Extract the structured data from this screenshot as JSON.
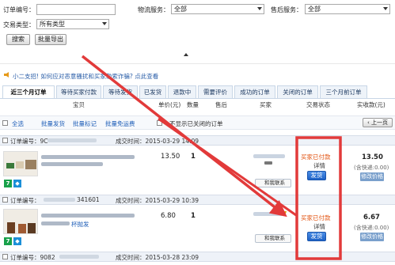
{
  "search": {
    "order_no_label": "订单编号：",
    "logistics_label": "物流服务：",
    "logistics_value": "全部",
    "aftersale_label": "售后服务：",
    "aftersale_value": "全部",
    "trade_type_label": "交易类型：",
    "trade_type_value": "所有类型",
    "search_button": "搜索",
    "export_button": "批量导出"
  },
  "notice": {
    "text": "小二支招! 如何应对恶意骚扰和买家勒索诈骗? 点此查看"
  },
  "tabs": [
    "近三个月订单",
    "等待买家付款",
    "等待发货",
    "已发货",
    "退款中",
    "需要评价",
    "成功的订单",
    "关闭的订单",
    "三个月前订单"
  ],
  "columns": {
    "item": "宝贝",
    "unit_price": "单价(元)",
    "quantity": "数量",
    "aftersale": "售后",
    "buyer": "买家",
    "trade_status": "交易状态",
    "paid": "实收款(元)"
  },
  "bulk": {
    "select_all": "全选",
    "batch_ship": "批量发货",
    "batch_mark": "批量标记",
    "batch_free_ship": "批量免运费",
    "hide_closed": "不显示已关闭的订单",
    "prev_page": "上一页"
  },
  "orders": [
    {
      "order_no": "订单编号：9C",
      "created": "成交时间：2015-03-29  14:09",
      "price": "13.50",
      "qty": "1",
      "status": "买家已付款",
      "detail": "详情",
      "ship": "发货",
      "total": "13.50",
      "shipping_note": "(含快递:0.00)",
      "modify_price": "修改价格",
      "msg": "和我联系"
    },
    {
      "order_no": "订单编号：",
      "order_no_tail": "341601",
      "created": "成交时间：2015-03-29  10:39",
      "price": "6.80",
      "qty": "1",
      "status": "买家已付款",
      "detail": "详情",
      "ship": "发货",
      "total": "6.67",
      "shipping_note": "(含快递:0.00)",
      "modify_price": "修改价格",
      "msg": "和我联系",
      "title_tail": "杯抛发"
    },
    {
      "order_no": "订单编号：9082",
      "created": "成交时间：2015-03-28  23:09"
    }
  ],
  "colors": {
    "arrow": "#e23a3a",
    "status_orange": "#e2520f",
    "ship_blue": "#1e62c6",
    "tab_border": "#c8d6e6"
  }
}
